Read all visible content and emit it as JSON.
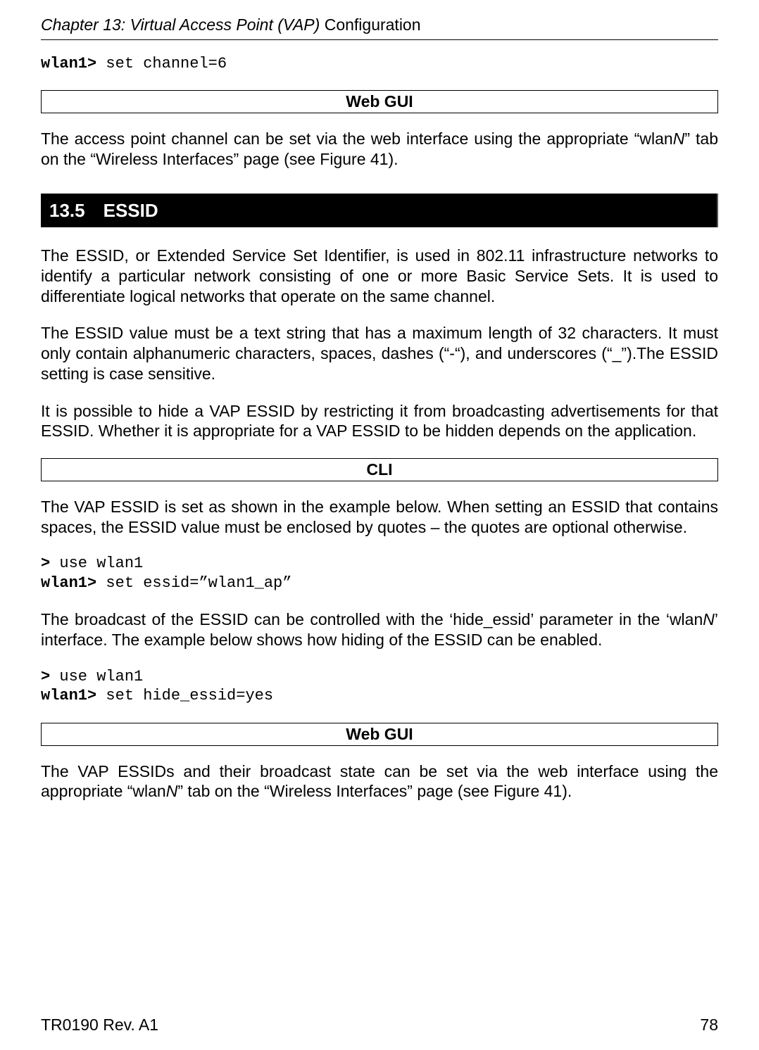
{
  "header": {
    "chapter_prefix": "Chapter 13: Virtual Access Point (VAP) ",
    "chapter_suffix": "Configuration"
  },
  "code_block1": {
    "prompt": "wlan1>",
    "cmd": " set channel=6"
  },
  "webgui_label1": "Web GUI",
  "para1_a": "The access point channel can be set via the web interface using the appropriate “wlan",
  "para1_n": "N",
  "para1_b": "” tab on the “Wireless Interfaces” page (see Figure 41).",
  "section": {
    "num": "13.5",
    "title": "ESSID"
  },
  "para2": "The ESSID, or Extended Service Set Identifier, is used in 802.11 infrastructure networks to identify a particular network consisting of one or more Basic Service Sets. It is used to differentiate logical networks that operate on the same channel.",
  "para3": "The ESSID value must be a text string that has a maximum length of 32 characters. It must only contain alphanumeric characters, spaces, dashes (“-“), and underscores (“_”).The ESSID setting is case sensitive.",
  "para4": "It is possible to hide a VAP ESSID by restricting it from broadcasting advertisements for that ESSID. Whether it is appropriate for a VAP ESSID to be hidden depends on the application.",
  "cli_label": "CLI",
  "para5": "The VAP ESSID is set as shown in the example below. When setting an ESSID that contains spaces, the ESSID value must be enclosed by quotes – the quotes are optional otherwise.",
  "code_block2": {
    "p1": ">",
    "c1": " use wlan1",
    "p2": "wlan1>",
    "c2": " set essid=”wlan1_ap”"
  },
  "para6_a": "The broadcast of the ESSID can be controlled with the ‘hide_essid’ parameter in the ‘wlan",
  "para6_n": "N",
  "para6_b": "’ interface. The example below shows how hiding of the ESSID can be enabled.",
  "code_block3": {
    "p1": ">",
    "c1": " use wlan1",
    "p2": "wlan1>",
    "c2": " set hide_essid=yes"
  },
  "webgui_label2": "Web GUI",
  "para7_a": "The VAP ESSIDs and their broadcast state can be set via the web interface using the appropriate “wlan",
  "para7_n": "N",
  "para7_b": "” tab on the “Wireless Interfaces” page (see Figure 41).",
  "footer": {
    "left": "TR0190 Rev. A1",
    "right": "78"
  }
}
